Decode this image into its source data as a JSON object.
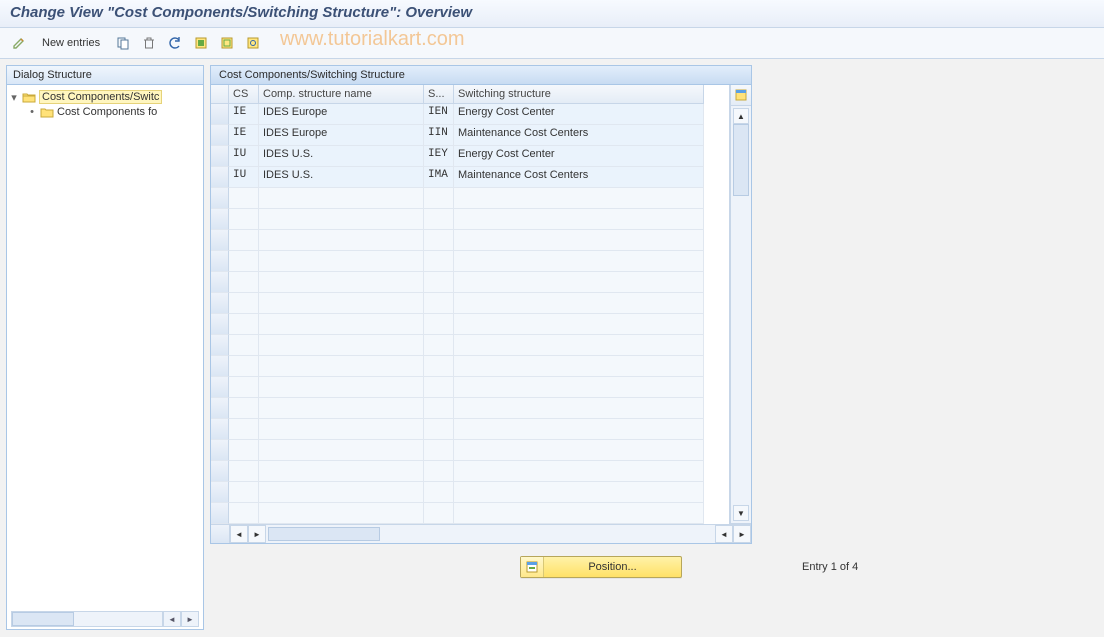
{
  "title": "Change View \"Cost Components/Switching Structure\": Overview",
  "toolbar": {
    "new_entries_label": "New entries"
  },
  "watermark": "www.tutorialkart.com",
  "tree": {
    "header": "Dialog Structure",
    "root_label": "Cost Components/Switc",
    "child_label": "Cost Components fo"
  },
  "table": {
    "title": "Cost Components/Switching Structure",
    "cols": {
      "cs": "CS",
      "name": "Comp. structure name",
      "s": "S...",
      "switch": "Switching structure"
    },
    "rows": [
      {
        "cs": "IE",
        "name": "IDES Europe",
        "s": "IEN",
        "switch": "Energy Cost Center"
      },
      {
        "cs": "IE",
        "name": "IDES Europe",
        "s": "IIN",
        "switch": "Maintenance Cost Centers"
      },
      {
        "cs": "IU",
        "name": "IDES U.S.",
        "s": "IEY",
        "switch": "Energy Cost Center"
      },
      {
        "cs": "IU",
        "name": "IDES U.S.",
        "s": "IMA",
        "switch": "Maintenance Cost Centers"
      }
    ],
    "empty_row_count": 16
  },
  "footer": {
    "position_label": "Position...",
    "entry_text": "Entry 1 of 4"
  }
}
